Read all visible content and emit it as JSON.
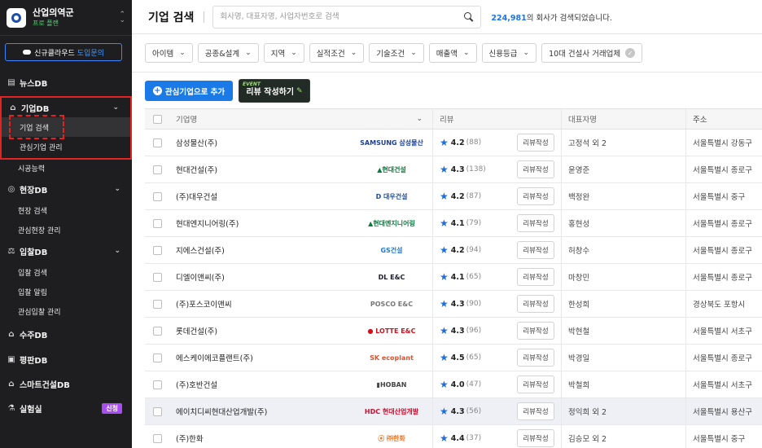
{
  "org": {
    "name": "산업의역군",
    "plan": "프로 플랜"
  },
  "contact_button": {
    "label_white": "신규클라우드",
    "label_blue": "도입문의"
  },
  "nav": {
    "news": "뉴스DB",
    "company_db": "기업DB",
    "company_search": "기업 검색",
    "company_watch": "관심기업 관리",
    "construction_capability": "시공능력",
    "site_db": "현장DB",
    "site_search": "현장 검색",
    "site_watch": "관심현장 관리",
    "bid_db": "입찰DB",
    "bid_search": "입찰 검색",
    "bid_alert": "입찰 알림",
    "bid_watch": "관심입찰 관리",
    "order_db": "수주DB",
    "reputation_db": "평판DB",
    "smart_db": "스마트건설DB",
    "lab": "실험실",
    "lab_badge": "신청"
  },
  "header": {
    "title": "기업 검색",
    "search_placeholder": "회사명, 대표자명, 사업자번호로 검색",
    "count_number": "224,981",
    "count_suffix": "의 회사가 검색되었습니다."
  },
  "filters": [
    "아이템",
    "공종&설계",
    "지역",
    "실적조건",
    "기술조건",
    "매출액",
    "신용등급"
  ],
  "filter_toggle": "10대 건설사 거래업체",
  "actions": {
    "add_label": "관심기업으로 추가",
    "event_tag": "EVENT",
    "review_label": "리뷰 작성하기"
  },
  "table": {
    "headers": {
      "name": "기업명",
      "review": "리뷰",
      "ceo": "대표자명",
      "address": "주소"
    },
    "write_label": "리뷰작성",
    "rows": [
      {
        "name": "삼성물산(주)",
        "logo": "SAMSUNG 삼성물산",
        "logo_color": "#1c3f94",
        "rating": "4.2",
        "count": "(88)",
        "ceo": "고정석 외 2",
        "address": "서울특별시 강동구"
      },
      {
        "name": "현대건설(주)",
        "logo": "▲현대건설",
        "logo_color": "#0a7a3c",
        "rating": "4.3",
        "count": "(138)",
        "ceo": "윤영준",
        "address": "서울특별시 종로구"
      },
      {
        "name": "(주)대우건설",
        "logo": "D 대우건설",
        "logo_color": "#1d4f9a",
        "rating": "4.2",
        "count": "(87)",
        "ceo": "백정완",
        "address": "서울특별시 중구"
      },
      {
        "name": "현대엔지니어링(주)",
        "logo": "▲현대엔지니어링",
        "logo_color": "#0a7a3c",
        "rating": "4.1",
        "count": "(79)",
        "ceo": "홍현성",
        "address": "서울특별시 종로구"
      },
      {
        "name": "지에스건설(주)",
        "logo": "GS건설",
        "logo_color": "#1f7bd1",
        "rating": "4.2",
        "count": "(94)",
        "ceo": "허창수",
        "address": "서울특별시 종로구"
      },
      {
        "name": "디엘이앤씨(주)",
        "logo": "DL E&C",
        "logo_color": "#1a1a2e",
        "rating": "4.1",
        "count": "(65)",
        "ceo": "마창민",
        "address": "서울특별시 종로구"
      },
      {
        "name": "(주)포스코이앤씨",
        "logo": "POSCO E&C",
        "logo_color": "#777777",
        "rating": "4.3",
        "count": "(90)",
        "ceo": "한성희",
        "address": "경상북도 포항시"
      },
      {
        "name": "롯데건설(주)",
        "logo": "● LOTTE E&C",
        "logo_color": "#d4101c",
        "rating": "4.3",
        "count": "(96)",
        "ceo": "박현철",
        "address": "서울특별시 서초구"
      },
      {
        "name": "에스케이에코플랜트(주)",
        "logo": "SK ecoplant",
        "logo_color": "#e0512c",
        "rating": "4.5",
        "count": "(65)",
        "ceo": "박경일",
        "address": "서울특별시 종로구"
      },
      {
        "name": "(주)호반건설",
        "logo": "▮HOBAN",
        "logo_color": "#454545",
        "rating": "4.0",
        "count": "(47)",
        "ceo": "박철희",
        "address": "서울특별시 서초구"
      },
      {
        "name": "에이치디씨현대산업개발(주)",
        "logo": "HDC 현대산업개발",
        "logo_color": "#c8102e",
        "rating": "4.3",
        "count": "(56)",
        "ceo": "정익희 외 2",
        "address": "서울특별시 용산구"
      },
      {
        "name": "(주)한화",
        "logo": "⦿ ㈜한화",
        "logo_color": "#f37321",
        "rating": "4.4",
        "count": "(37)",
        "ceo": "김승모 외 2",
        "address": "서울특별시 중구"
      }
    ]
  }
}
